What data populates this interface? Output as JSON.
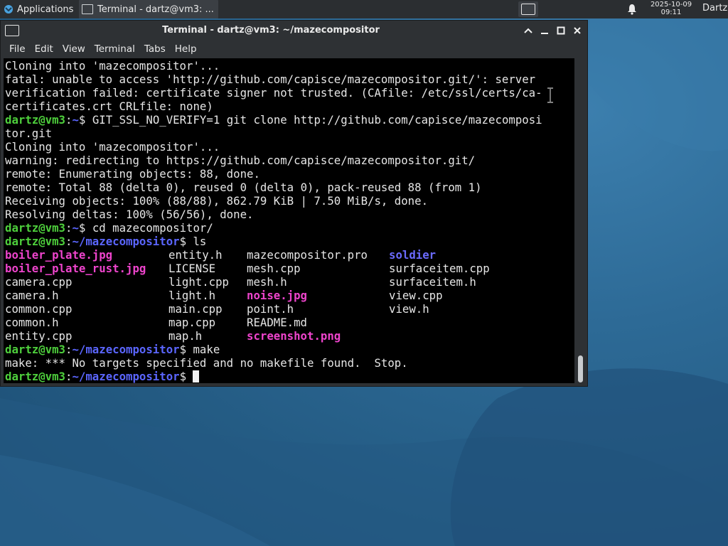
{
  "panel": {
    "apps_label": "Applications",
    "task_label": "Terminal - dartz@vm3: ...",
    "clock_date": "2025-10-09",
    "clock_time": "09:11",
    "user_label": "Dartz",
    "icons": [
      "xfce-menu-icon",
      "terminal-icon",
      "bell-icon"
    ]
  },
  "window": {
    "title": "Terminal - dartz@vm3: ~/mazecompositor",
    "buttons": [
      "▲",
      "▁",
      "◻",
      "✕"
    ],
    "menu": [
      "File",
      "Edit",
      "View",
      "Terminal",
      "Tabs",
      "Help"
    ]
  },
  "colors": {
    "prompt_user": "#4ecf3c",
    "prompt_path": "#5b66ff",
    "image_file": "#ee44cc",
    "directory": "#6b6bff",
    "terminal_bg": "#000000",
    "chrome_bg": "#2e3134"
  },
  "terminal": {
    "prompt_user": "dartz@vm3",
    "colon": ":",
    "home_path": "~",
    "repo_path": "~/mazecompositor",
    "dollar": "$ ",
    "lines": {
      "l1": "Cloning into 'mazecompositor'...",
      "l2": "fatal: unable to access 'http://github.com/capisce/mazecompositor.git/': server",
      "l3": "verification failed: certificate signer not trusted. (CAfile: /etc/ssl/certs/ca-",
      "l4": "certificates.crt CRLfile: none)",
      "cmd1": "GIT_SSL_NO_VERIFY=1 git clone http://github.com/capisce/mazecomposi",
      "cmd1b": "tor.git",
      "l6": "Cloning into 'mazecompositor'...",
      "l7": "warning: redirecting to https://github.com/capisce/mazecompositor.git/",
      "l8": "remote: Enumerating objects: 88, done.",
      "l9": "remote: Total 88 (delta 0), reused 0 (delta 0), pack-reused 88 (from 1)",
      "l10": "Receiving objects: 100% (88/88), 862.79 KiB | 7.50 MiB/s, done.",
      "l11": "Resolving deltas: 100% (56/56), done.",
      "cmd2": "cd mazecompositor/",
      "cmd3": "ls",
      "cmd4": "make",
      "make_out": "make: *** No targets specified and no makefile found.  Stop."
    },
    "ls": {
      "c1": [
        "boiler_plate.jpg",
        "boiler_plate_rust.jpg",
        "camera.cpp",
        "camera.h",
        "common.cpp",
        "common.h",
        "entity.cpp"
      ],
      "c2": [
        "entity.h",
        "LICENSE",
        "light.cpp",
        "light.h",
        "main.cpp",
        "map.cpp",
        "map.h"
      ],
      "c3": [
        "mazecompositor.pro",
        "mesh.cpp",
        "mesh.h",
        "noise.jpg",
        "point.h",
        "README.md",
        "screenshot.png"
      ],
      "c4": [
        "soldier",
        "surfaceitem.cpp",
        "surfaceitem.h",
        "view.cpp",
        "view.h"
      ]
    }
  }
}
